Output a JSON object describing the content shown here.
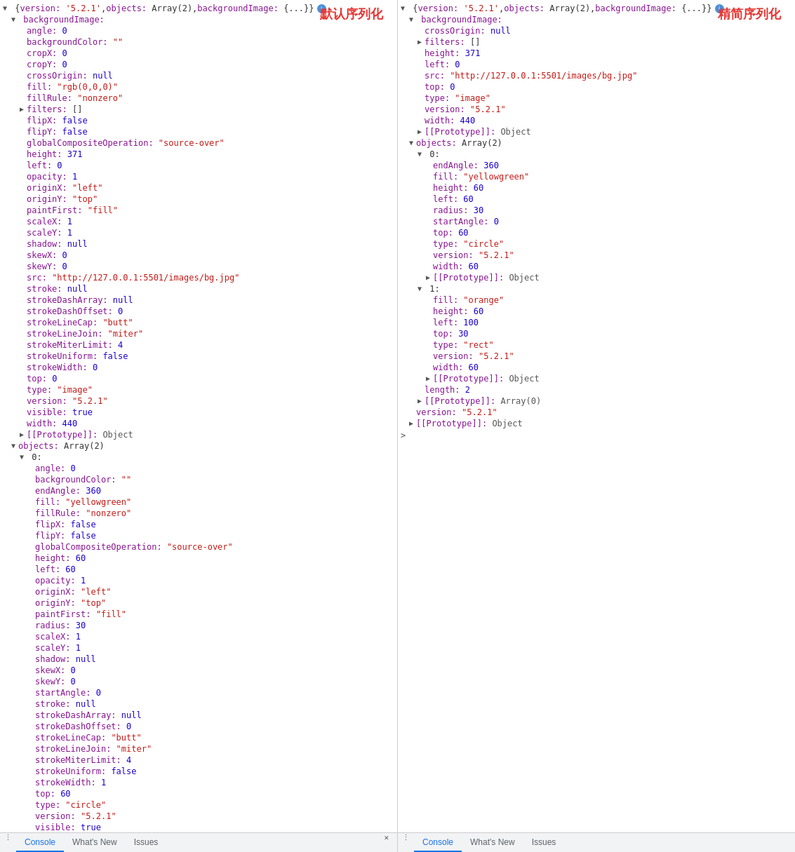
{
  "left_panel": {
    "label": "默认序列化",
    "header": "{version: '5.2.1', objects: Array(2), backgroundImage: {...}}",
    "content": [
      {
        "indent": 0,
        "arrow": "down",
        "text": "",
        "type": "header",
        "raw": "▼ {version: '5.2.1', objects: Array(2), backgroundImage: {...}}"
      },
      {
        "indent": 1,
        "arrow": "down",
        "key": "backgroundImage:",
        "type": "section"
      },
      {
        "indent": 2,
        "arrow": "none",
        "key": "angle:",
        "val": "0",
        "valtype": "num"
      },
      {
        "indent": 2,
        "arrow": "none",
        "key": "backgroundColor:",
        "val": "\"\"",
        "valtype": "str"
      },
      {
        "indent": 2,
        "arrow": "none",
        "key": "cropX:",
        "val": "0",
        "valtype": "num"
      },
      {
        "indent": 2,
        "arrow": "none",
        "key": "cropY:",
        "val": "0",
        "valtype": "num"
      },
      {
        "indent": 2,
        "arrow": "none",
        "key": "crossOrigin:",
        "val": "null",
        "valtype": "null"
      },
      {
        "indent": 2,
        "arrow": "none",
        "key": "fill:",
        "val": "\"rgb(0,0,0)\"",
        "valtype": "str"
      },
      {
        "indent": 2,
        "arrow": "none",
        "key": "fillRule:",
        "val": "\"nonzero\"",
        "valtype": "str"
      },
      {
        "indent": 2,
        "arrow": "right",
        "key": "filters:",
        "val": "[]",
        "valtype": "plain"
      },
      {
        "indent": 2,
        "arrow": "none",
        "key": "flipX:",
        "val": "false",
        "valtype": "bool"
      },
      {
        "indent": 2,
        "arrow": "none",
        "key": "flipY:",
        "val": "false",
        "valtype": "bool"
      },
      {
        "indent": 2,
        "arrow": "none",
        "key": "globalCompositeOperation:",
        "val": "\"source-over\"",
        "valtype": "str"
      },
      {
        "indent": 2,
        "arrow": "none",
        "key": "height:",
        "val": "371",
        "valtype": "num"
      },
      {
        "indent": 2,
        "arrow": "none",
        "key": "left:",
        "val": "0",
        "valtype": "num"
      },
      {
        "indent": 2,
        "arrow": "none",
        "key": "opacity:",
        "val": "1",
        "valtype": "num"
      },
      {
        "indent": 2,
        "arrow": "none",
        "key": "originX:",
        "val": "\"left\"",
        "valtype": "str"
      },
      {
        "indent": 2,
        "arrow": "none",
        "key": "originY:",
        "val": "\"top\"",
        "valtype": "str"
      },
      {
        "indent": 2,
        "arrow": "none",
        "key": "paintFirst:",
        "val": "\"fill\"",
        "valtype": "str"
      },
      {
        "indent": 2,
        "arrow": "none",
        "key": "scaleX:",
        "val": "1",
        "valtype": "num"
      },
      {
        "indent": 2,
        "arrow": "none",
        "key": "scaleY:",
        "val": "1",
        "valtype": "num"
      },
      {
        "indent": 2,
        "arrow": "none",
        "key": "shadow:",
        "val": "null",
        "valtype": "null"
      },
      {
        "indent": 2,
        "arrow": "none",
        "key": "skewX:",
        "val": "0",
        "valtype": "num"
      },
      {
        "indent": 2,
        "arrow": "none",
        "key": "skewY:",
        "val": "0",
        "valtype": "num"
      },
      {
        "indent": 2,
        "arrow": "none",
        "key": "src:",
        "val": "\"http://127.0.0.1:5501/images/bg.jpg\"",
        "valtype": "str"
      },
      {
        "indent": 2,
        "arrow": "none",
        "key": "stroke:",
        "val": "null",
        "valtype": "null"
      },
      {
        "indent": 2,
        "arrow": "none",
        "key": "strokeDashArray:",
        "val": "null",
        "valtype": "null"
      },
      {
        "indent": 2,
        "arrow": "none",
        "key": "strokeDashOffset:",
        "val": "0",
        "valtype": "num"
      },
      {
        "indent": 2,
        "arrow": "none",
        "key": "strokeLineCap:",
        "val": "\"butt\"",
        "valtype": "str"
      },
      {
        "indent": 2,
        "arrow": "none",
        "key": "strokeLineJoin:",
        "val": "\"miter\"",
        "valtype": "str"
      },
      {
        "indent": 2,
        "arrow": "none",
        "key": "strokeMiterLimit:",
        "val": "4",
        "valtype": "num"
      },
      {
        "indent": 2,
        "arrow": "none",
        "key": "strokeUniform:",
        "val": "false",
        "valtype": "bool"
      },
      {
        "indent": 2,
        "arrow": "none",
        "key": "strokeWidth:",
        "val": "0",
        "valtype": "num"
      },
      {
        "indent": 2,
        "arrow": "none",
        "key": "top:",
        "val": "0",
        "valtype": "num"
      },
      {
        "indent": 2,
        "arrow": "none",
        "key": "type:",
        "val": "\"image\"",
        "valtype": "str"
      },
      {
        "indent": 2,
        "arrow": "none",
        "key": "version:",
        "val": "\"5.2.1\"",
        "valtype": "str"
      },
      {
        "indent": 2,
        "arrow": "none",
        "key": "visible:",
        "val": "true",
        "valtype": "bool"
      },
      {
        "indent": 2,
        "arrow": "none",
        "key": "width:",
        "val": "440",
        "valtype": "num"
      },
      {
        "indent": 2,
        "arrow": "right",
        "key": "[[Prototype]]:",
        "val": "Object",
        "valtype": "proto"
      },
      {
        "indent": 1,
        "arrow": "down",
        "key": "objects:",
        "val": "Array(2)",
        "valtype": "plain"
      },
      {
        "indent": 2,
        "arrow": "down",
        "key": "▼ 0:",
        "type": "index"
      },
      {
        "indent": 3,
        "arrow": "none",
        "key": "angle:",
        "val": "0",
        "valtype": "num"
      },
      {
        "indent": 3,
        "arrow": "none",
        "key": "backgroundColor:",
        "val": "\"\"",
        "valtype": "str"
      },
      {
        "indent": 3,
        "arrow": "none",
        "key": "endAngle:",
        "val": "360",
        "valtype": "num"
      },
      {
        "indent": 3,
        "arrow": "none",
        "key": "fill:",
        "val": "\"yellowgreen\"",
        "valtype": "str"
      },
      {
        "indent": 3,
        "arrow": "none",
        "key": "fillRule:",
        "val": "\"nonzero\"",
        "valtype": "str"
      },
      {
        "indent": 3,
        "arrow": "none",
        "key": "flipX:",
        "val": "false",
        "valtype": "bool"
      },
      {
        "indent": 3,
        "arrow": "none",
        "key": "flipY:",
        "val": "false",
        "valtype": "bool"
      },
      {
        "indent": 3,
        "arrow": "none",
        "key": "globalCompositeOperation:",
        "val": "\"source-over\"",
        "valtype": "str"
      },
      {
        "indent": 3,
        "arrow": "none",
        "key": "height:",
        "val": "60",
        "valtype": "num"
      },
      {
        "indent": 3,
        "arrow": "none",
        "key": "left:",
        "val": "60",
        "valtype": "num"
      },
      {
        "indent": 3,
        "arrow": "none",
        "key": "opacity:",
        "val": "1",
        "valtype": "num"
      },
      {
        "indent": 3,
        "arrow": "none",
        "key": "originX:",
        "val": "\"left\"",
        "valtype": "str"
      },
      {
        "indent": 3,
        "arrow": "none",
        "key": "originY:",
        "val": "\"top\"",
        "valtype": "str"
      },
      {
        "indent": 3,
        "arrow": "none",
        "key": "paintFirst:",
        "val": "\"fill\"",
        "valtype": "str"
      },
      {
        "indent": 3,
        "arrow": "none",
        "key": "radius:",
        "val": "30",
        "valtype": "num"
      },
      {
        "indent": 3,
        "arrow": "none",
        "key": "scaleX:",
        "val": "1",
        "valtype": "num"
      },
      {
        "indent": 3,
        "arrow": "none",
        "key": "scaleY:",
        "val": "1",
        "valtype": "num"
      },
      {
        "indent": 3,
        "arrow": "none",
        "key": "shadow:",
        "val": "null",
        "valtype": "null"
      },
      {
        "indent": 3,
        "arrow": "none",
        "key": "skewX:",
        "val": "0",
        "valtype": "num"
      },
      {
        "indent": 3,
        "arrow": "none",
        "key": "skewY:",
        "val": "0",
        "valtype": "num"
      },
      {
        "indent": 3,
        "arrow": "none",
        "key": "startAngle:",
        "val": "0",
        "valtype": "num"
      },
      {
        "indent": 3,
        "arrow": "none",
        "key": "stroke:",
        "val": "null",
        "valtype": "null"
      },
      {
        "indent": 3,
        "arrow": "none",
        "key": "strokeDashArray:",
        "val": "null",
        "valtype": "null"
      },
      {
        "indent": 3,
        "arrow": "none",
        "key": "strokeDashOffset:",
        "val": "0",
        "valtype": "num"
      },
      {
        "indent": 3,
        "arrow": "none",
        "key": "strokeLineCap:",
        "val": "\"butt\"",
        "valtype": "str"
      },
      {
        "indent": 3,
        "arrow": "none",
        "key": "strokeLineJoin:",
        "val": "\"miter\"",
        "valtype": "str"
      },
      {
        "indent": 3,
        "arrow": "none",
        "key": "strokeMiterLimit:",
        "val": "4",
        "valtype": "num"
      },
      {
        "indent": 3,
        "arrow": "none",
        "key": "strokeUniform:",
        "val": "false",
        "valtype": "bool"
      },
      {
        "indent": 3,
        "arrow": "none",
        "key": "strokeWidth:",
        "val": "1",
        "valtype": "num"
      },
      {
        "indent": 3,
        "arrow": "none",
        "key": "top:",
        "val": "60",
        "valtype": "num"
      },
      {
        "indent": 3,
        "arrow": "none",
        "key": "type:",
        "val": "\"circle\"",
        "valtype": "str"
      },
      {
        "indent": 3,
        "arrow": "none",
        "key": "version:",
        "val": "\"5.2.1\"",
        "valtype": "str"
      },
      {
        "indent": 3,
        "arrow": "none",
        "key": "visible:",
        "val": "true",
        "valtype": "bool"
      }
    ]
  },
  "right_panel": {
    "label": "精简序列化",
    "header": "{version: '5.2.1', objects: Array(2), backgroundImage: {...}}",
    "content": [
      {
        "indent": 0,
        "arrow": "down",
        "text": "",
        "type": "header",
        "raw": "▼ {version: '5.2.1', objects: Array(2), backgroundImage: {...}}"
      },
      {
        "indent": 1,
        "arrow": "down",
        "key": "backgroundImage:",
        "type": "section"
      },
      {
        "indent": 2,
        "arrow": "none",
        "key": "crossOrigin:",
        "val": "null",
        "valtype": "null"
      },
      {
        "indent": 2,
        "arrow": "right",
        "key": "filters:",
        "val": "[]",
        "valtype": "plain"
      },
      {
        "indent": 2,
        "arrow": "none",
        "key": "height:",
        "val": "371",
        "valtype": "num"
      },
      {
        "indent": 2,
        "arrow": "none",
        "key": "left:",
        "val": "0",
        "valtype": "num"
      },
      {
        "indent": 2,
        "arrow": "none",
        "key": "src:",
        "val": "\"http://127.0.0.1:5501/images/bg.jpg\"",
        "valtype": "str"
      },
      {
        "indent": 2,
        "arrow": "none",
        "key": "top:",
        "val": "0",
        "valtype": "num"
      },
      {
        "indent": 2,
        "arrow": "none",
        "key": "type:",
        "val": "\"image\"",
        "valtype": "str"
      },
      {
        "indent": 2,
        "arrow": "none",
        "key": "version:",
        "val": "\"5.2.1\"",
        "valtype": "str"
      },
      {
        "indent": 2,
        "arrow": "none",
        "key": "width:",
        "val": "440",
        "valtype": "num"
      },
      {
        "indent": 2,
        "arrow": "right",
        "key": "[[Prototype]]:",
        "val": "Object",
        "valtype": "proto"
      },
      {
        "indent": 1,
        "arrow": "down",
        "key": "objects:",
        "val": "Array(2)",
        "valtype": "plain"
      },
      {
        "indent": 2,
        "arrow": "down",
        "key": "▼ 0:",
        "type": "index"
      },
      {
        "indent": 3,
        "arrow": "none",
        "key": "endAngle:",
        "val": "360",
        "valtype": "num"
      },
      {
        "indent": 3,
        "arrow": "none",
        "key": "fill:",
        "val": "\"yellowgreen\"",
        "valtype": "str"
      },
      {
        "indent": 3,
        "arrow": "none",
        "key": "height:",
        "val": "60",
        "valtype": "num"
      },
      {
        "indent": 3,
        "arrow": "none",
        "key": "left:",
        "val": "60",
        "valtype": "num"
      },
      {
        "indent": 3,
        "arrow": "none",
        "key": "radius:",
        "val": "30",
        "valtype": "num"
      },
      {
        "indent": 3,
        "arrow": "none",
        "key": "startAngle:",
        "val": "0",
        "valtype": "num"
      },
      {
        "indent": 3,
        "arrow": "none",
        "key": "top:",
        "val": "60",
        "valtype": "num"
      },
      {
        "indent": 3,
        "arrow": "none",
        "key": "type:",
        "val": "\"circle\"",
        "valtype": "str"
      },
      {
        "indent": 3,
        "arrow": "none",
        "key": "version:",
        "val": "\"5.2.1\"",
        "valtype": "str"
      },
      {
        "indent": 3,
        "arrow": "none",
        "key": "width:",
        "val": "60",
        "valtype": "num"
      },
      {
        "indent": 3,
        "arrow": "right",
        "key": "[[Prototype]]:",
        "val": "Object",
        "valtype": "proto"
      },
      {
        "indent": 2,
        "arrow": "down",
        "key": "▼ 1:",
        "type": "index"
      },
      {
        "indent": 3,
        "arrow": "none",
        "key": "fill:",
        "val": "\"orange\"",
        "valtype": "str"
      },
      {
        "indent": 3,
        "arrow": "none",
        "key": "height:",
        "val": "60",
        "valtype": "num"
      },
      {
        "indent": 3,
        "arrow": "none",
        "key": "left:",
        "val": "100",
        "valtype": "num"
      },
      {
        "indent": 3,
        "arrow": "none",
        "key": "top:",
        "val": "30",
        "valtype": "num"
      },
      {
        "indent": 3,
        "arrow": "none",
        "key": "type:",
        "val": "\"rect\"",
        "valtype": "str"
      },
      {
        "indent": 3,
        "arrow": "none",
        "key": "version:",
        "val": "\"5.2.1\"",
        "valtype": "str"
      },
      {
        "indent": 3,
        "arrow": "none",
        "key": "width:",
        "val": "60",
        "valtype": "num"
      },
      {
        "indent": 3,
        "arrow": "right",
        "key": "[[Prototype]]:",
        "val": "Object",
        "valtype": "proto"
      },
      {
        "indent": 2,
        "arrow": "none",
        "key": "length:",
        "val": "2",
        "valtype": "num"
      },
      {
        "indent": 2,
        "arrow": "right",
        "key": "[[Prototype]]:",
        "val": "Array(0)",
        "valtype": "proto"
      },
      {
        "indent": 1,
        "arrow": "none",
        "key": "version:",
        "val": "\"5.2.1\"",
        "valtype": "str"
      },
      {
        "indent": 1,
        "arrow": "right",
        "key": "[[Prototype]]:",
        "val": "Object",
        "valtype": "proto"
      }
    ]
  },
  "bottom_tabs": {
    "left": {
      "icon_dots": "⋮",
      "tabs": [
        "Console",
        "What's New",
        "Issues"
      ],
      "active": "Console",
      "arrow": "✕"
    },
    "right": {
      "icon_dots": "⋮",
      "tabs": [
        "Console",
        "What's New",
        "Issues"
      ],
      "active": "Console",
      "arrow": ">"
    }
  }
}
